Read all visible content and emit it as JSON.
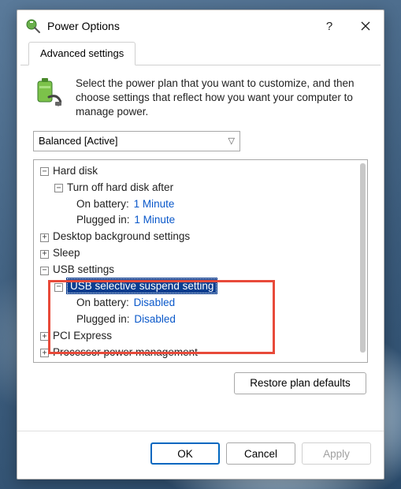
{
  "titlebar": {
    "title": "Power Options",
    "help_label": "?",
    "close_label": "✕"
  },
  "tab": {
    "label": "Advanced settings"
  },
  "intro": "Select the power plan that you want to customize, and then choose settings that reflect how you want your computer to manage power.",
  "plan": {
    "selected": "Balanced [Active]"
  },
  "tree": {
    "hard_disk": {
      "label": "Hard disk",
      "turn_off_label": "Turn off hard disk after",
      "on_battery_label": "On battery:",
      "on_battery_value": "1 Minute",
      "plugged_in_label": "Plugged in:",
      "plugged_in_value": "1 Minute"
    },
    "desktop_bg": {
      "label": "Desktop background settings"
    },
    "sleep": {
      "label": "Sleep"
    },
    "usb": {
      "label": "USB settings",
      "selective_label": "USB selective suspend setting",
      "on_battery_label": "On battery:",
      "on_battery_value": "Disabled",
      "plugged_in_label": "Plugged in:",
      "plugged_in_value": "Disabled"
    },
    "pci": {
      "label": "PCI Express"
    },
    "proc": {
      "label": "Processor power management"
    }
  },
  "buttons": {
    "restore": "Restore plan defaults",
    "ok": "OK",
    "cancel": "Cancel",
    "apply": "Apply"
  },
  "toggle": {
    "plus": "+",
    "minus": "−"
  }
}
